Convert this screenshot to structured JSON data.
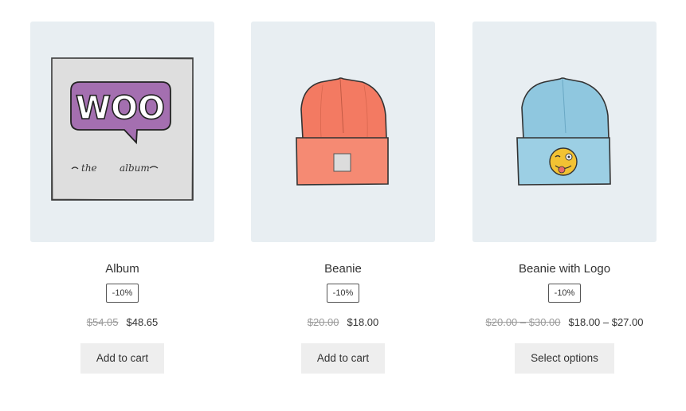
{
  "products": [
    {
      "title": "Album",
      "badge": "-10%",
      "old_price": "$54.05",
      "new_price": "$48.65",
      "button": "Add to cart",
      "image_icon": "woo-album-cover-image"
    },
    {
      "title": "Beanie",
      "badge": "-10%",
      "old_price": "$20.00",
      "new_price": "$18.00",
      "button": "Add to cart",
      "image_icon": "orange-beanie-image"
    },
    {
      "title": "Beanie with Logo",
      "badge": "-10%",
      "old_price": "$20.00 – $30.00",
      "new_price": "$18.00 – $27.00",
      "button": "Select options",
      "image_icon": "blue-beanie-with-logo-image"
    }
  ],
  "album_cover": {
    "logo_text": "WOO",
    "caption_left": "the",
    "caption_right": "album"
  },
  "colors": {
    "thumb_bg": "#e8eef2",
    "button_bg": "#eeeeee",
    "woo_purple": "#a46fb0",
    "beanie_orange": "#f37a62",
    "beanie_blue": "#8fc7df",
    "emoji_yellow": "#f2c233"
  }
}
